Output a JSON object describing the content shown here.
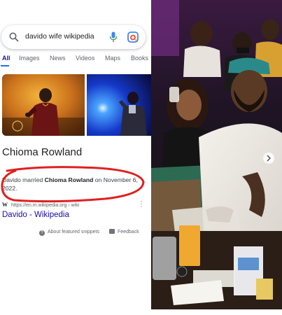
{
  "search": {
    "query": "davido wife wikipedia"
  },
  "tabs": [
    "All",
    "Images",
    "News",
    "Videos",
    "Maps",
    "Books"
  ],
  "knowledge_panel": {
    "title": "Chioma Rowland",
    "snippet_prefix": "Davido married ",
    "snippet_bold": "Chioma Rowland",
    "snippet_mid": " on ",
    "snippet_date": "November 6, 2022.",
    "source_icon": "W",
    "source_url": "https://en.m.wikipedia.org › wiki",
    "result_title": "Davido - Wikipedia",
    "about_label": "About featured snippets",
    "feedback_label": "Feedback"
  },
  "colors": {
    "link_blue": "#1a0dab",
    "annotation_red": "#e02020",
    "tab_active": "#1a73e8"
  }
}
